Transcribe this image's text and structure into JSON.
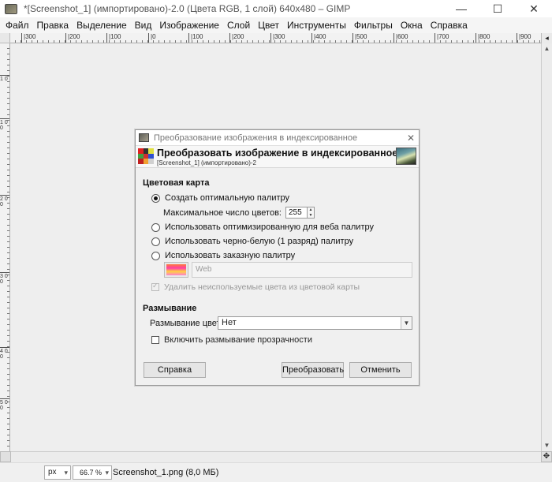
{
  "window": {
    "title": "*[Screenshot_1] (импортировано)-2.0 (Цвета RGB, 1 слой) 640x480 – GIMP",
    "minimize": "—",
    "maximize": "☐",
    "close": "✕"
  },
  "menu": [
    "Файл",
    "Правка",
    "Выделение",
    "Вид",
    "Изображение",
    "Слой",
    "Цвет",
    "Инструменты",
    "Фильтры",
    "Окна",
    "Справка"
  ],
  "ruler": {
    "h_labels": [
      "|300",
      "|200",
      "|100",
      "|0",
      "|100",
      "|200",
      "|300",
      "|400",
      "|500",
      "|600",
      "|700",
      "|800",
      "|900"
    ],
    "v_labels": [
      "1 0",
      "1 0 0",
      "2 0 0",
      "3 0 0",
      "4 0 0",
      "5 0 0"
    ]
  },
  "statusbar": {
    "unit": "px",
    "zoom": "66.7 %",
    "file_info": "Screenshot_1.png (8,0 МБ)"
  },
  "dialog": {
    "window_title": "Преобразование изображения в индексированное",
    "header_title": "Преобразовать изображение в индексированное",
    "header_subtitle": "[Screenshot_1] (импортировано)-2",
    "colormap_section": "Цветовая карта",
    "options": {
      "optimal": "Создать оптимальную палитру",
      "max_colors_label": "Максимальное число цветов:",
      "max_colors_value": "255",
      "web": "Использовать оптимизированную для веба палитру",
      "bw": "Использовать черно-белую (1 разряд) палитру",
      "custom": "Использовать заказную палитру",
      "custom_palette_name": "Web",
      "remove_unused": "Удалить неиспользуемые цвета из цветовой карты"
    },
    "dither_section": "Размывание",
    "dither_color_label": "Размывание цвета:",
    "dither_color_value": "Нет",
    "dither_transparency": "Включить размывание прозрачности",
    "buttons": {
      "help": "Справка",
      "convert": "Преобразовать",
      "cancel": "Отменить"
    },
    "close": "✕"
  }
}
